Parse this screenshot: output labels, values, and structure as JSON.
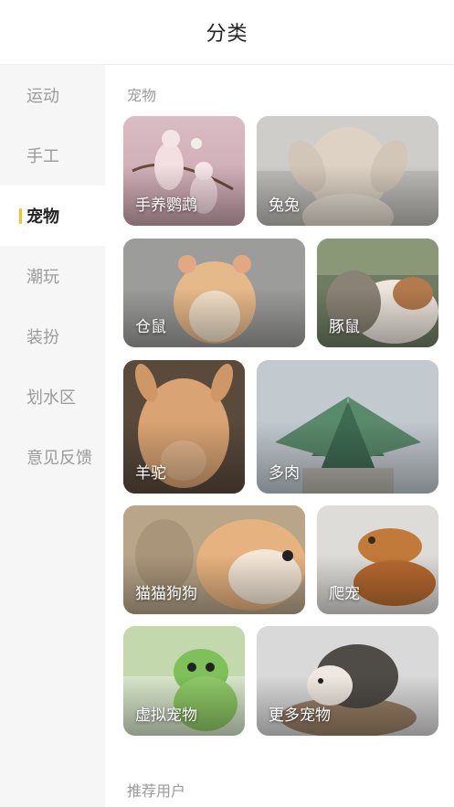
{
  "header": {
    "title": "分类"
  },
  "sidebar": {
    "accent_color": "#f5c623",
    "items": [
      {
        "label": "运动"
      },
      {
        "label": "手工"
      },
      {
        "label": "宠物",
        "active": true
      },
      {
        "label": "潮玩"
      },
      {
        "label": "装扮"
      },
      {
        "label": "划水区"
      },
      {
        "label": "意见反馈"
      }
    ]
  },
  "main": {
    "section_title": "宠物",
    "cards": [
      {
        "label": "手养鹦鹉",
        "icon": "parrot-image"
      },
      {
        "label": "兔兔",
        "icon": "rabbit-image"
      },
      {
        "label": "仓鼠",
        "icon": "hamster-image"
      },
      {
        "label": "豚鼠",
        "icon": "guinea-pig-image"
      },
      {
        "label": "羊驼",
        "icon": "alpaca-image"
      },
      {
        "label": "多肉",
        "icon": "succulent-image"
      },
      {
        "label": "猫猫狗狗",
        "icon": "cat-dog-image"
      },
      {
        "label": "爬宠",
        "icon": "reptile-image"
      },
      {
        "label": "虚拟宠物",
        "icon": "virtual-frog-image"
      },
      {
        "label": "更多宠物",
        "icon": "hedgehog-image"
      }
    ],
    "next_section_title": "推荐用户"
  }
}
